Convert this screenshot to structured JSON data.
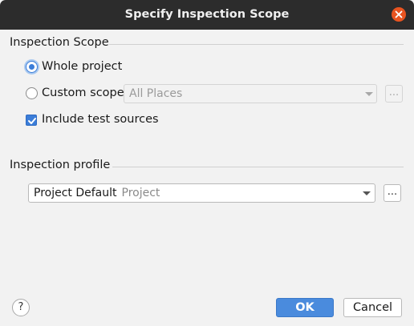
{
  "window": {
    "title": "Specify Inspection Scope"
  },
  "scope": {
    "section_label": "Inspection Scope",
    "whole_project_label": "Whole project",
    "whole_project_selected": true,
    "custom_scope_label": "Custom scope",
    "custom_scope_selected": false,
    "custom_scope_value": "All Places",
    "browse_label": "...",
    "include_tests_label": "Include test sources",
    "include_tests_checked": true
  },
  "profile": {
    "section_label": "Inspection profile",
    "selected_name": "Project Default",
    "selected_type": "Project",
    "browse_label": "..."
  },
  "footer": {
    "help_label": "?",
    "ok_label": "OK",
    "cancel_label": "Cancel"
  },
  "colors": {
    "accent": "#3b7dd8",
    "close": "#e95420",
    "titlebar": "#2c2c2c"
  }
}
